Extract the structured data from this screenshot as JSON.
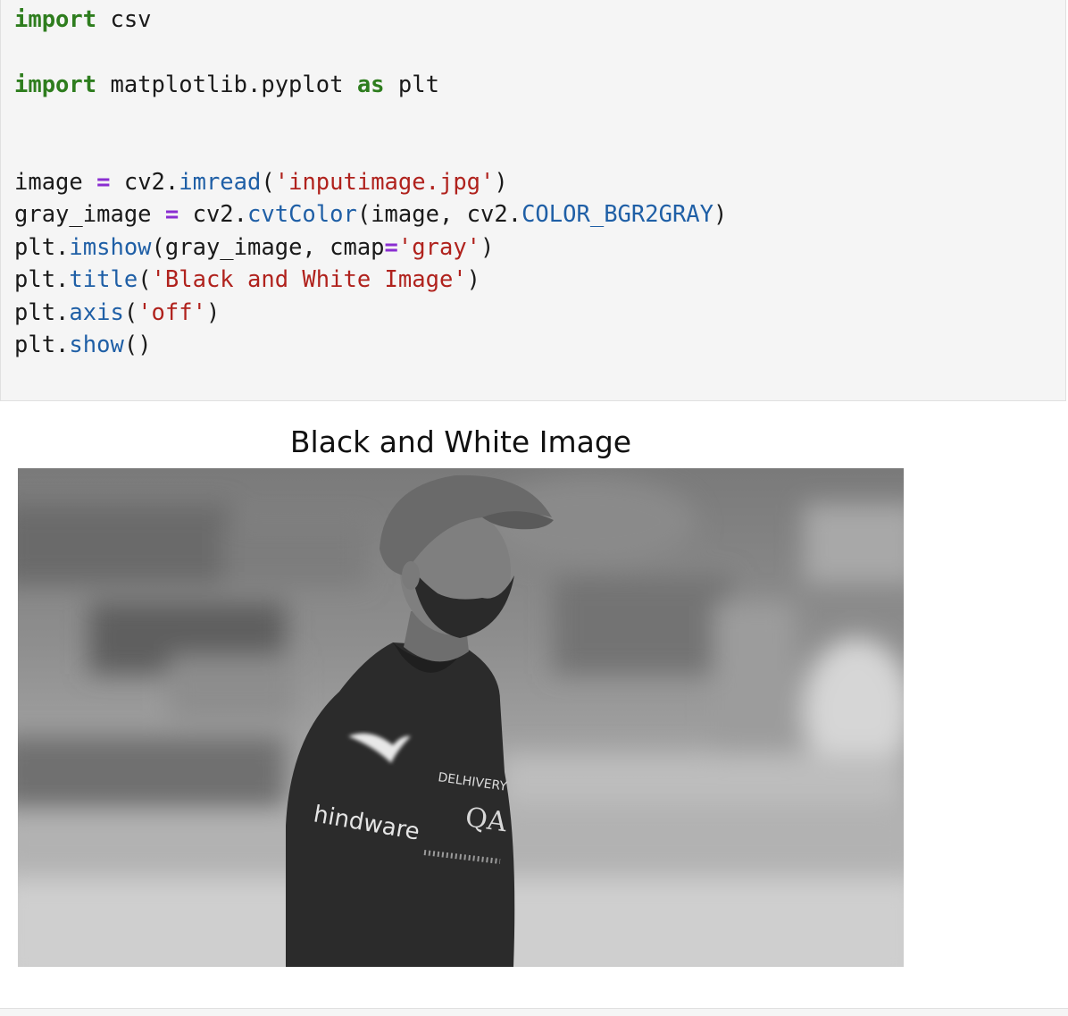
{
  "code_cell": {
    "lines": [
      [
        {
          "t": "import",
          "c": "kw"
        },
        {
          "t": " csv",
          "c": ""
        }
      ],
      [],
      [
        {
          "t": "import",
          "c": "kw"
        },
        {
          "t": " matplotlib.pyplot ",
          "c": ""
        },
        {
          "t": "as",
          "c": "kw"
        },
        {
          "t": " plt",
          "c": ""
        }
      ],
      [],
      [],
      [
        {
          "t": "image ",
          "c": ""
        },
        {
          "t": "=",
          "c": "op"
        },
        {
          "t": " cv2.",
          "c": ""
        },
        {
          "t": "imread",
          "c": "fn"
        },
        {
          "t": "(",
          "c": ""
        },
        {
          "t": "'inputimage.jpg'",
          "c": "str"
        },
        {
          "t": ")",
          "c": ""
        }
      ],
      [
        {
          "t": "gray_image ",
          "c": ""
        },
        {
          "t": "=",
          "c": "op"
        },
        {
          "t": " cv2.",
          "c": ""
        },
        {
          "t": "cvtColor",
          "c": "fn"
        },
        {
          "t": "(image, cv2.",
          "c": ""
        },
        {
          "t": "COLOR_BGR2GRAY",
          "c": "attr"
        },
        {
          "t": ")",
          "c": ""
        }
      ],
      [
        {
          "t": "plt.",
          "c": ""
        },
        {
          "t": "imshow",
          "c": "fn"
        },
        {
          "t": "(gray_image, cmap",
          "c": ""
        },
        {
          "t": "=",
          "c": "op"
        },
        {
          "t": "'gray'",
          "c": "str"
        },
        {
          "t": ")",
          "c": ""
        }
      ],
      [
        {
          "t": "plt.",
          "c": ""
        },
        {
          "t": "title",
          "c": "fn"
        },
        {
          "t": "(",
          "c": ""
        },
        {
          "t": "'Black and White Image'",
          "c": "str"
        },
        {
          "t": ")",
          "c": ""
        }
      ],
      [
        {
          "t": "plt.",
          "c": ""
        },
        {
          "t": "axis",
          "c": "fn"
        },
        {
          "t": "(",
          "c": ""
        },
        {
          "t": "'off'",
          "c": "str"
        },
        {
          "t": ")",
          "c": ""
        }
      ],
      [
        {
          "t": "plt.",
          "c": ""
        },
        {
          "t": "show",
          "c": "fn"
        },
        {
          "t": "()",
          "c": ""
        }
      ]
    ]
  },
  "output": {
    "plot_title": "Black and White Image",
    "image_description": "grayscale photo of cricketer in cap and team jersey looking up",
    "jersey_text": [
      "hindware",
      "QATAR AIRWAYS",
      "DELHIVERY"
    ]
  },
  "colors": {
    "cell_background": "#f5f5f5",
    "keyword": "#2e7d1e",
    "operator": "#8a2ed1",
    "function": "#1f5fa6",
    "string": "#b0221d"
  }
}
